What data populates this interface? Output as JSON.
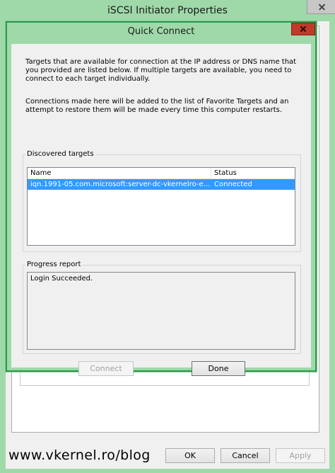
{
  "parent": {
    "title": "iSCSI Initiator Properties",
    "buttons": {
      "ok": "OK",
      "cancel": "Cancel",
      "apply": "Apply"
    },
    "watermark": "www.vkernel.ro/blog"
  },
  "dialog": {
    "title": "Quick Connect",
    "intro_text": "Targets that are available for connection at the IP address or DNS name that you provided are listed below.  If multiple targets are available, you need to connect to each target individually.",
    "favorites_text": "Connections made here will be added to the list of Favorite Targets and an attempt to restore them will be made every time this computer restarts.",
    "discovered": {
      "label": "Discovered targets",
      "columns": [
        "Name",
        "Status"
      ],
      "rows": [
        {
          "name": "iqn.1991-05.com.microsoft:server-dc-vkernelro-esx...",
          "status": "Connected"
        }
      ]
    },
    "progress": {
      "label": "Progress report",
      "text": "Login Succeeded."
    },
    "buttons": {
      "connect": "Connect",
      "done": "Done"
    }
  },
  "colors": {
    "window_frame": "#9fd9a9",
    "dialog_border": "#2e9b4d",
    "close_button": "#c0392b",
    "selection": "#3399ff"
  }
}
